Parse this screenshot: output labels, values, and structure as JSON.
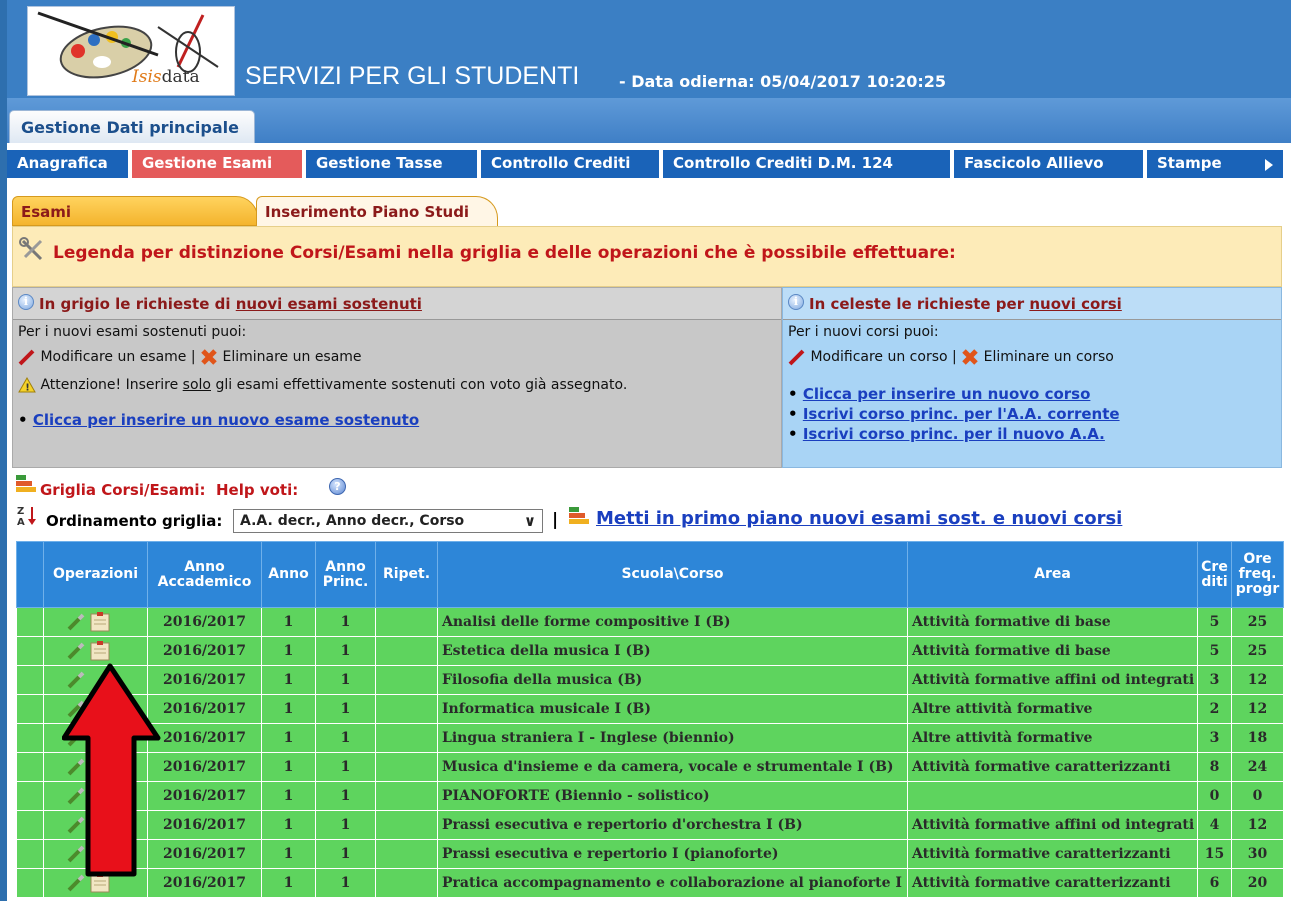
{
  "header": {
    "app_title": "SERVIZI PER GLI STUDENTI",
    "date_label": "- Data odierna: 05/04/2017 10:20:25",
    "logo_text_a": "Isis",
    "logo_text_b": "data",
    "main_tab": "Gestione Dati principale"
  },
  "nav": {
    "items": [
      {
        "label": "Anagrafica",
        "active": false
      },
      {
        "label": "Gestione Esami",
        "active": true
      },
      {
        "label": "Gestione Tasse",
        "active": false
      },
      {
        "label": "Controllo Crediti",
        "active": false
      },
      {
        "label": "Controllo Crediti D.M. 124",
        "active": false
      },
      {
        "label": "Fascicolo Allievo",
        "active": false
      },
      {
        "label": "Stampe",
        "active": false
      }
    ]
  },
  "subtabs": [
    "Esami",
    "Inserimento Piano Studi"
  ],
  "legend": {
    "title": "Legenda per distinzione Corsi/Esami nella griglia e delle operazioni che è possibile effettuare:"
  },
  "grey_panel": {
    "head_prefix": "In grigio le richieste di ",
    "head_link": "nuovi esami sostenuti",
    "intro": "Per i nuovi esami sostenuti puoi:",
    "modify": "Modificare un esame |",
    "delete": "Eliminare un esame",
    "warning_prefix": "Attenzione! Inserire ",
    "warning_em": "solo",
    "warning_suffix": " gli esami effettivamente sostenuti con voto già assegnato.",
    "link": "Clicca per inserire un nuovo esame sostenuto"
  },
  "blue_panel": {
    "head_prefix": "In celeste le richieste per ",
    "head_link": "nuovi corsi",
    "intro": "Per i nuovi corsi puoi:",
    "modify": "Modificare un corso |",
    "delete": "Eliminare un corso",
    "links": [
      "Clicca per inserire un nuovo corso",
      "Iscrivi corso princ. per l'A.A. corrente",
      "Iscrivi corso princ. per il nuovo A.A."
    ]
  },
  "grid": {
    "title": "Griglia Corsi/Esami:",
    "help": "Help voti:",
    "order_label": "Ordinamento griglia:",
    "order_value": "A.A. decr., Anno decr., Corso",
    "front_link": "Metti in primo piano nuovi esami sost. e nuovi corsi",
    "headers": {
      "ops": "Operazioni",
      "aa_1": "Anno",
      "aa_2": "Accademico",
      "anno": "Anno",
      "princ_1": "Anno",
      "princ_2": "Princ.",
      "ripet": "Ripet.",
      "corso": "Scuola\\Corso",
      "area": "Area",
      "crediti_1": "Cre",
      "crediti_2": "diti",
      "ore_1": "Ore",
      "ore_2": "freq.",
      "ore_3": "progr"
    },
    "rows": [
      {
        "aa": "2016/2017",
        "anno": "1",
        "princ": "1",
        "ripet": "",
        "corso": "Analisi delle forme compositive I   (B)",
        "area": "Attività formative di base",
        "crediti": "5",
        "ore": "25",
        "doc": true
      },
      {
        "aa": "2016/2017",
        "anno": "1",
        "princ": "1",
        "ripet": "",
        "corso": "Estetica della musica I  (B)",
        "area": "Attività formative di base",
        "crediti": "5",
        "ore": "25",
        "doc": true
      },
      {
        "aa": "2016/2017",
        "anno": "1",
        "princ": "1",
        "ripet": "",
        "corso": "Filosofia della musica  (B)",
        "area": "Attività formative affini od integrati",
        "crediti": "3",
        "ore": "12",
        "doc": false
      },
      {
        "aa": "2016/2017",
        "anno": "1",
        "princ": "1",
        "ripet": "",
        "corso": "Informatica musicale I  (B)",
        "area": "Altre attività formative",
        "crediti": "2",
        "ore": "12",
        "doc": false
      },
      {
        "aa": "2016/2017",
        "anno": "1",
        "princ": "1",
        "ripet": "",
        "corso": "Lingua straniera I - Inglese (biennio)",
        "area": "Altre attività formative",
        "crediti": "3",
        "ore": "18",
        "doc": false
      },
      {
        "aa": "2016/2017",
        "anno": "1",
        "princ": "1",
        "ripet": "",
        "corso": "Musica d'insieme e da camera, vocale e strumentale I   (B)",
        "area": "Attività formative caratterizzanti",
        "crediti": "8",
        "ore": "24",
        "doc": false
      },
      {
        "aa": "2016/2017",
        "anno": "1",
        "princ": "1",
        "ripet": "",
        "corso": "PIANOFORTE (Biennio - solistico)",
        "area": "",
        "crediti": "0",
        "ore": "0",
        "doc": false
      },
      {
        "aa": "2016/2017",
        "anno": "1",
        "princ": "1",
        "ripet": "",
        "corso": "Prassi esecutiva e repertorio d'orchestra I   (B)",
        "area": "Attività formative affini od integrati",
        "crediti": "4",
        "ore": "12",
        "doc": false
      },
      {
        "aa": "2016/2017",
        "anno": "1",
        "princ": "1",
        "ripet": "",
        "corso": "Prassi esecutiva e repertorio I (pianoforte)",
        "area": "Attività formative caratterizzanti",
        "crediti": "15",
        "ore": "30",
        "doc": true
      },
      {
        "aa": "2016/2017",
        "anno": "1",
        "princ": "1",
        "ripet": "",
        "corso": "Pratica accompagnamento e collaborazione al pianoforte I",
        "area": "Attività formative caratterizzanti",
        "crediti": "6",
        "ore": "20",
        "doc": true
      }
    ]
  },
  "colors": {
    "header_blue": "#3b7fc4",
    "nav_blue": "#1a63b8",
    "nav_active": "#e45b5b",
    "row_green": "#5ed45e",
    "grid_header": "#2d86d8",
    "arrow_red": "#e8101a"
  }
}
